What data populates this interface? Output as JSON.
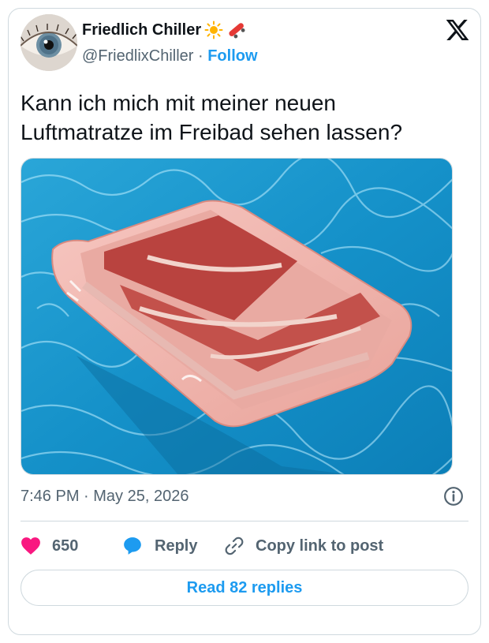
{
  "author": {
    "name": "Friedlich Chiller",
    "emoji": [
      "sun-icon",
      "skateboard-icon"
    ],
    "handle": "@FriedlixChiller",
    "separator": "·",
    "follow_label": "Follow"
  },
  "tweet": {
    "text_line1": "Kann ich mich mit meiner neuen",
    "text_line2": "Luftmatratze im Freibad sehen lassen?"
  },
  "meta": {
    "time": "7:46 PM",
    "separator": "·",
    "date": "May 25, 2026"
  },
  "actions": {
    "like_count": "650",
    "reply_label": "Reply",
    "copy_label": "Copy link to post"
  },
  "read_replies_label": "Read 82 replies",
  "colors": {
    "accent": "#1d9bf0",
    "like": "#f91880",
    "text": "#0f1419",
    "secondary": "#536471",
    "border": "#cfd9de"
  }
}
